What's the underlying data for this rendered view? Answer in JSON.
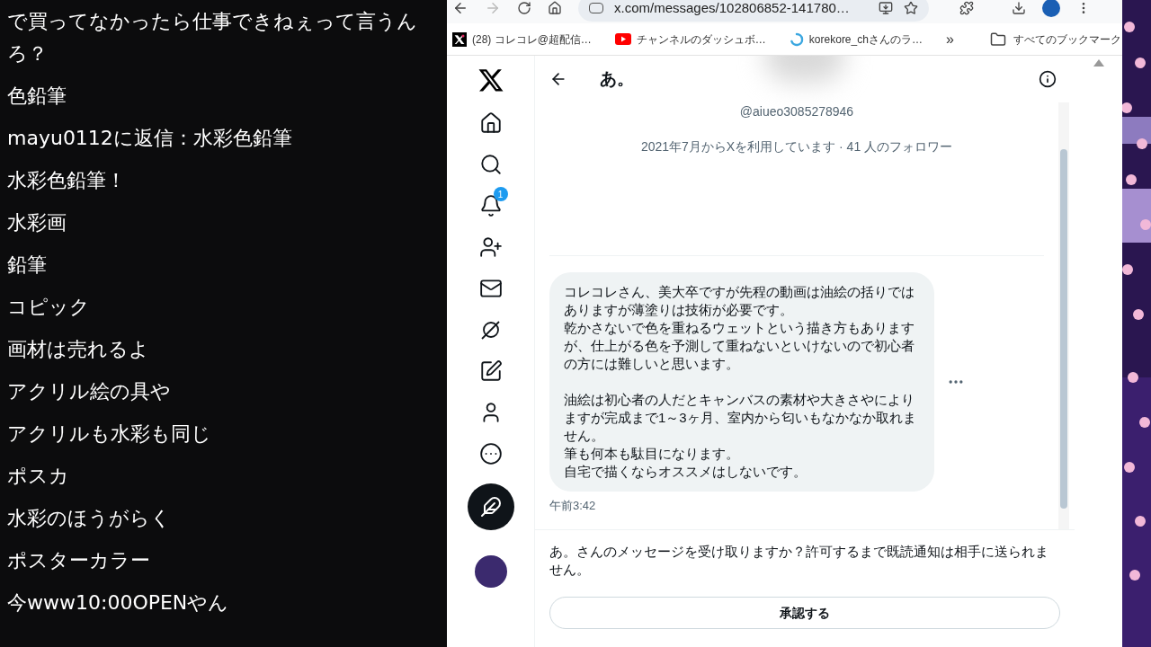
{
  "chat": {
    "comments": [
      {
        "lines": [
          "で買ってなかったら仕事できねぇって言うん",
          "ろ？"
        ]
      },
      {
        "lines": [
          "色鉛筆"
        ]
      },
      {
        "lines": [
          "mayu0112に返信：水彩色鉛筆"
        ]
      },
      {
        "lines": [
          "水彩色鉛筆！"
        ]
      },
      {
        "lines": [
          "水彩画"
        ]
      },
      {
        "lines": [
          "鉛筆"
        ]
      },
      {
        "lines": [
          "コピック"
        ]
      },
      {
        "lines": [
          "画材は売れるよ"
        ]
      },
      {
        "lines": [
          "アクリル絵の具や"
        ]
      },
      {
        "lines": [
          "アクリルも水彩も同じ"
        ]
      },
      {
        "lines": [
          "ポスカ"
        ]
      },
      {
        "lines": [
          "水彩のほうがらく"
        ]
      },
      {
        "lines": [
          "ポスターカラー"
        ]
      },
      {
        "lines": [
          "今www10:00OPENやん"
        ]
      }
    ]
  },
  "browser": {
    "address": "x.com/messages/102806852-141780…",
    "bookmarks": [
      {
        "kind": "x",
        "label": "(28) コレコレ@超配信…"
      },
      {
        "kind": "youtube",
        "label": "チャンネルのダッシュボ…"
      },
      {
        "kind": "ring",
        "label": "korekore_chさんのラ…"
      }
    ],
    "overflow": "»",
    "all_bookmarks": "すべてのブックマーク"
  },
  "sidebar": {
    "notification_count": "1"
  },
  "conversation": {
    "title": "あ。",
    "handle": "@aiueo3085278946",
    "joined": "2021年7月からXを利用しています · 41 人のフォロワー",
    "message": {
      "paragraphs": [
        [
          "コレコレさん、美大卒ですが先程の動画は油絵の括りではありますが薄塗りは技術が必要です。",
          "乾かさないで色を重ねるウェットという描き方もありますが、仕上がる色を予測して重ねないといけないので初心者の方には難しいと思います。"
        ],
        [
          "油絵は初心者の人だとキャンバスの素材や大きさやによりますが完成まで1～3ヶ月、室内から匂いもなかなか取れません。",
          "筆も何本も駄目になります。",
          "自宅で描くならオススメはしないです。"
        ]
      ],
      "time": "午前3:42"
    },
    "request": "あ。さんのメッセージを受け取りますか？許可するまで既読通知は相手に送られません。",
    "accept_button": "承認する"
  }
}
